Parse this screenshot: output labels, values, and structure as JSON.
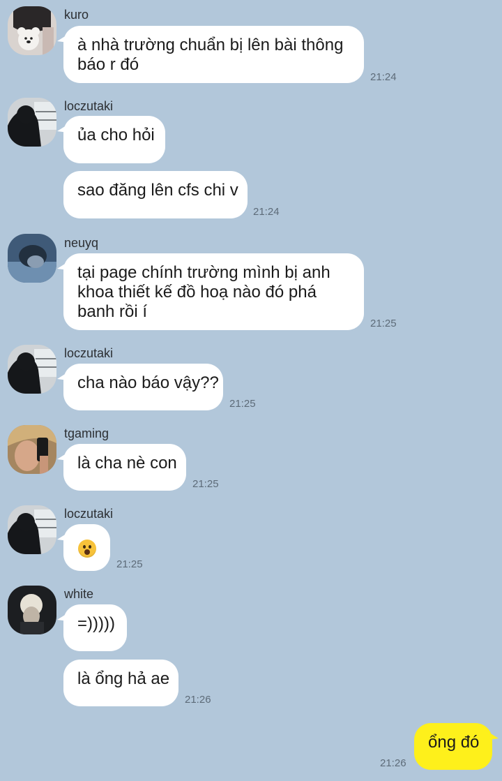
{
  "messages": [
    {
      "sender": "kuro",
      "bubbles": [
        "à nhà trường chuẩn bị lên bài thông báo r đó"
      ],
      "time": "21:24"
    },
    {
      "sender": "loczutaki",
      "bubbles": [
        "ủa cho hỏi",
        "sao đăng lên cfs chi v"
      ],
      "time": "21:24"
    },
    {
      "sender": "neuyq",
      "bubbles": [
        "tại page chính trường mình bị anh khoa thiết kế đồ hoạ nào đó phá banh rồi í"
      ],
      "time": "21:25"
    },
    {
      "sender": "loczutaki",
      "bubbles": [
        "cha nào báo vậy??"
      ],
      "time": "21:25"
    },
    {
      "sender": "tgaming",
      "bubbles": [
        "là cha nè con"
      ],
      "time": "21:25"
    },
    {
      "sender": "loczutaki",
      "bubbles": [
        "😦"
      ],
      "time": "21:25"
    },
    {
      "sender": "white",
      "bubbles": [
        "=)))))",
        "là ổng hả ae"
      ],
      "time": "21:26"
    }
  ],
  "my_message": {
    "text": "ổng đó",
    "time": "21:26"
  },
  "colors": {
    "background": "#b2c7da",
    "incoming_bubble": "#ffffff",
    "outgoing_bubble": "#fef01b"
  },
  "emoji_icon": "astonished-face-icon"
}
